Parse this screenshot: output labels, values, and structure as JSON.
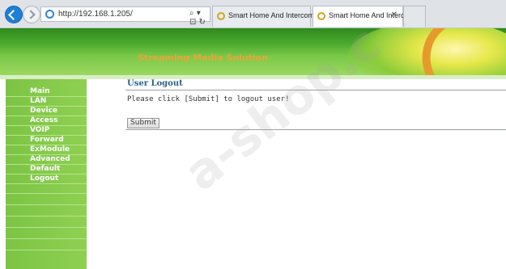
{
  "browser": {
    "address": "http://192.168.1.205/",
    "address_tools": "⌕ ▾ ⊡ ↻",
    "tabs": [
      {
        "label": "Smart Home And Intercom Sys...",
        "close": ""
      },
      {
        "label": "Smart Home And Intercom ...",
        "close": "✕"
      }
    ]
  },
  "banner": {
    "title": "Streaming Media Solution"
  },
  "sidebar": {
    "items": [
      "Main",
      "LAN",
      "Device",
      "Access",
      "VOIP",
      "Forward",
      "ExModule",
      "Advanced",
      "Default",
      "Logout"
    ]
  },
  "main": {
    "title": "User Logout",
    "instruction": "Please click [Submit] to logout user!",
    "submit_label": "Submit"
  },
  "watermark": "a-shop.c",
  "colors": {
    "sidebar_green": "#8ed052",
    "banner_green": "#48a82c",
    "banner_title": "#e8a53a",
    "page_title": "#2a5f89"
  }
}
